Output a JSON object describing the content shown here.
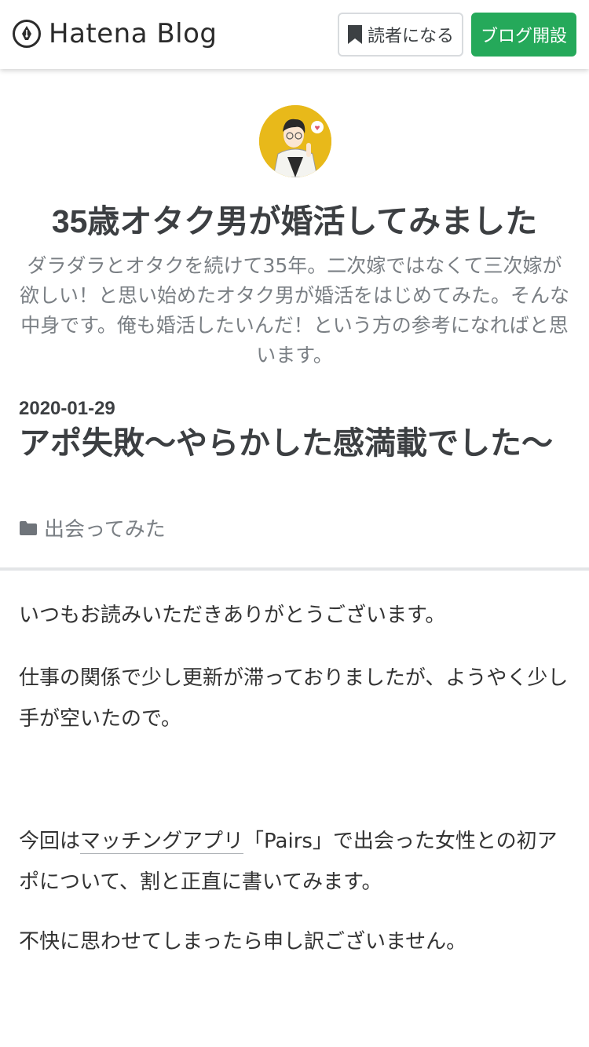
{
  "header": {
    "logo_text": "Hatena Blog",
    "reader_button_label": "読者になる",
    "open_blog_button_label": "ブログ開設",
    "accent_color": "#25a95a"
  },
  "blog": {
    "title": "35歳オタク男が婚活してみました",
    "description": "ダラダラとオタクを続けて35年。二次嫁ではなくて三次嫁が欲しい！と思い始めたオタク男が婚活をはじめてみた。そんな中身です。俺も婚活したいんだ！という方の参考になればと思います。"
  },
  "post": {
    "date": "2020-01-29",
    "title": "アポ失敗～やらかした感満載でした～",
    "category": "出会ってみた",
    "paragraphs": {
      "p1": "いつもお読みいただきありがとうございます。",
      "p2": "仕事の関係で少し更新が滞っておりましたが、ようやく少し手が空いたので。",
      "p3_before": "今回は",
      "p3_link": "マッチングアプリ",
      "p3_after": "「Pairs」で出会った女性との初アポについて、割と正直に書いてみます。",
      "p4": "不快に思わせてしまったら申し訳ございません。"
    }
  }
}
